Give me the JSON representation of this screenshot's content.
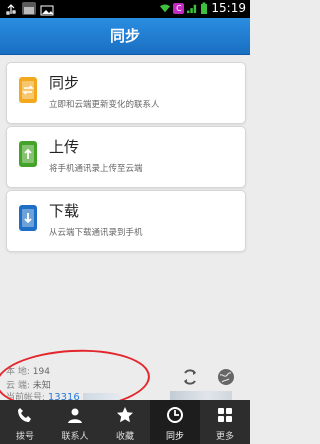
{
  "status_bar": {
    "time": "15:19",
    "sim_badge": "C",
    "icons": [
      "usb-icon",
      "signal-icon",
      "image-icon",
      "wifi-icon",
      "signal-bars-icon",
      "battery-icon"
    ]
  },
  "header": {
    "title": "同步"
  },
  "cards": [
    {
      "title": "同步",
      "desc": "立即和云端更新变化的联系人",
      "icon": "sync-icon",
      "color": "#f2a91e"
    },
    {
      "title": "上传",
      "desc": "将手机通讯录上传至云端",
      "icon": "upload-icon",
      "color": "#44a329"
    },
    {
      "title": "下载",
      "desc": "从云端下载通讯录到手机",
      "icon": "download-icon",
      "color": "#1f6fc6"
    }
  ],
  "info": {
    "local_label": "本  地:",
    "local_value": "194",
    "cloud_label": "云  端:",
    "cloud_value": "未知",
    "account_label": "当前帐号:",
    "account_value": "13316"
  },
  "tabs": [
    {
      "label": "拨号",
      "icon": "phone-icon"
    },
    {
      "label": "联系人",
      "icon": "contacts-icon"
    },
    {
      "label": "收藏",
      "icon": "star-icon"
    },
    {
      "label": "同步",
      "icon": "sync-tab-icon",
      "active": true
    },
    {
      "label": "更多",
      "icon": "more-icon"
    }
  ],
  "colors": {
    "accent": "#1a6fc2",
    "highlight": "#e3262b"
  }
}
